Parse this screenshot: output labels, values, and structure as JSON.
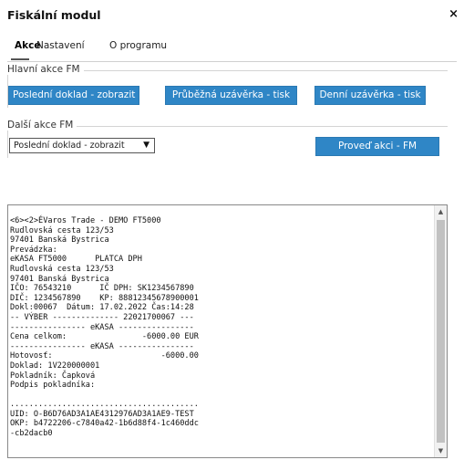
{
  "window": {
    "title": "Fiskální modul",
    "close_glyph": "×",
    "close_icon": "close-icon"
  },
  "tabs": [
    {
      "label": "Akce",
      "active": true
    },
    {
      "label": "Nastavení",
      "active": false
    },
    {
      "label": "O programu",
      "active": false
    }
  ],
  "main_group": {
    "legend": "Hlavní akce FM",
    "buttons": [
      "Poslední doklad - zobrazit",
      "Průběžná uzávěrka - tisk",
      "Denní uzávěrka - tisk"
    ]
  },
  "other_group": {
    "legend": "Další akce FM",
    "select_value": "Poslední doklad - zobrazit",
    "select_icon": "chevron-down-icon",
    "run_button": "Proveď akci - FM"
  },
  "output": {
    "lines": [
      "<6><2>ÉVaros Trade - DEMO FT5000",
      "Rudlovská cesta 123/53",
      "97401 Banská Bystrica",
      "Prevádzka:",
      "eKASA FT5000      PLATCA DPH",
      "Rudlovská cesta 123/53",
      "97401 Banská Bystrica",
      "IČO: 76543210      IČ DPH: SK1234567890",
      "DIČ: 1234567890    KP: 88812345678900001",
      "Dokl:00067  Dátum: 17.02.2022 Čas:14:28",
      "-- VÝBER -------------- 22021700067 ---",
      "---------------- eKASA ----------------",
      "Cena celkom:                -6000.00 EUR",
      "---------------- eKASA ----------------",
      "Hotovosť:                       -6000.00",
      "Doklad: 1V220000001",
      "Pokladník: Čapková",
      "Podpis pokladníka:",
      "",
      "........................................",
      "UID: O-B6D76AD3A1AE4312976AD3A1AE9-TEST",
      "OKP: b4722206-c7840a42-1b6d88f4-1c460ddc",
      "-cb2dacb0"
    ],
    "scroll_up_icon": "scroll-up-arrow-icon",
    "scroll_down_icon": "scroll-down-arrow-icon"
  },
  "colors": {
    "button_bg": "#2f86c6",
    "button_text": "#ffffff"
  }
}
